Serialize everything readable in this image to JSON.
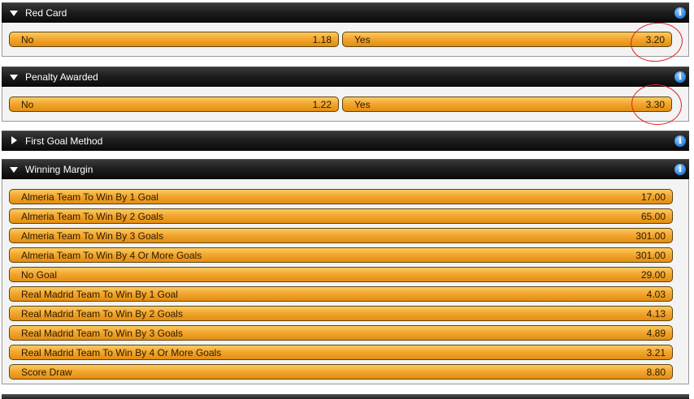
{
  "sections": [
    {
      "title": "Red Card",
      "expanded": true,
      "info_icon": "info-icon",
      "options": [
        {
          "label": "No",
          "odds": "1.18"
        },
        {
          "label": "Yes",
          "odds": "3.20"
        }
      ]
    },
    {
      "title": "Penalty Awarded",
      "expanded": true,
      "info_icon": "info-icon",
      "options": [
        {
          "label": "No",
          "odds": "1.22"
        },
        {
          "label": "Yes",
          "odds": "3.30"
        }
      ]
    },
    {
      "title": "First Goal Method",
      "expanded": false,
      "info_icon": "info-icon",
      "options": []
    },
    {
      "title": "Winning Margin",
      "expanded": true,
      "info_icon": "info-icon",
      "options": [
        {
          "label": "Almeria Team To Win By 1 Goal",
          "odds": "17.00"
        },
        {
          "label": "Almeria Team To Win By 2 Goals",
          "odds": "65.00"
        },
        {
          "label": "Almeria Team To Win By 3 Goals",
          "odds": "301.00"
        },
        {
          "label": "Almeria Team To Win By 4 Or More Goals",
          "odds": "301.00"
        },
        {
          "label": "No Goal",
          "odds": "29.00"
        },
        {
          "label": "Real Madrid Team To Win By 1 Goal",
          "odds": "4.03"
        },
        {
          "label": "Real Madrid Team To Win By 2 Goals",
          "odds": "4.13"
        },
        {
          "label": "Real Madrid Team To Win By 3 Goals",
          "odds": "4.89"
        },
        {
          "label": "Real Madrid Team To Win By 4 Or More Goals",
          "odds": "3.21"
        },
        {
          "label": "Score Draw",
          "odds": "8.80"
        }
      ]
    }
  ],
  "colors": {
    "button_fill": "#f2a42c",
    "button_border": "#5f4410",
    "header_bg": "#1e1e1e",
    "annotation_circle": "#e02020"
  }
}
